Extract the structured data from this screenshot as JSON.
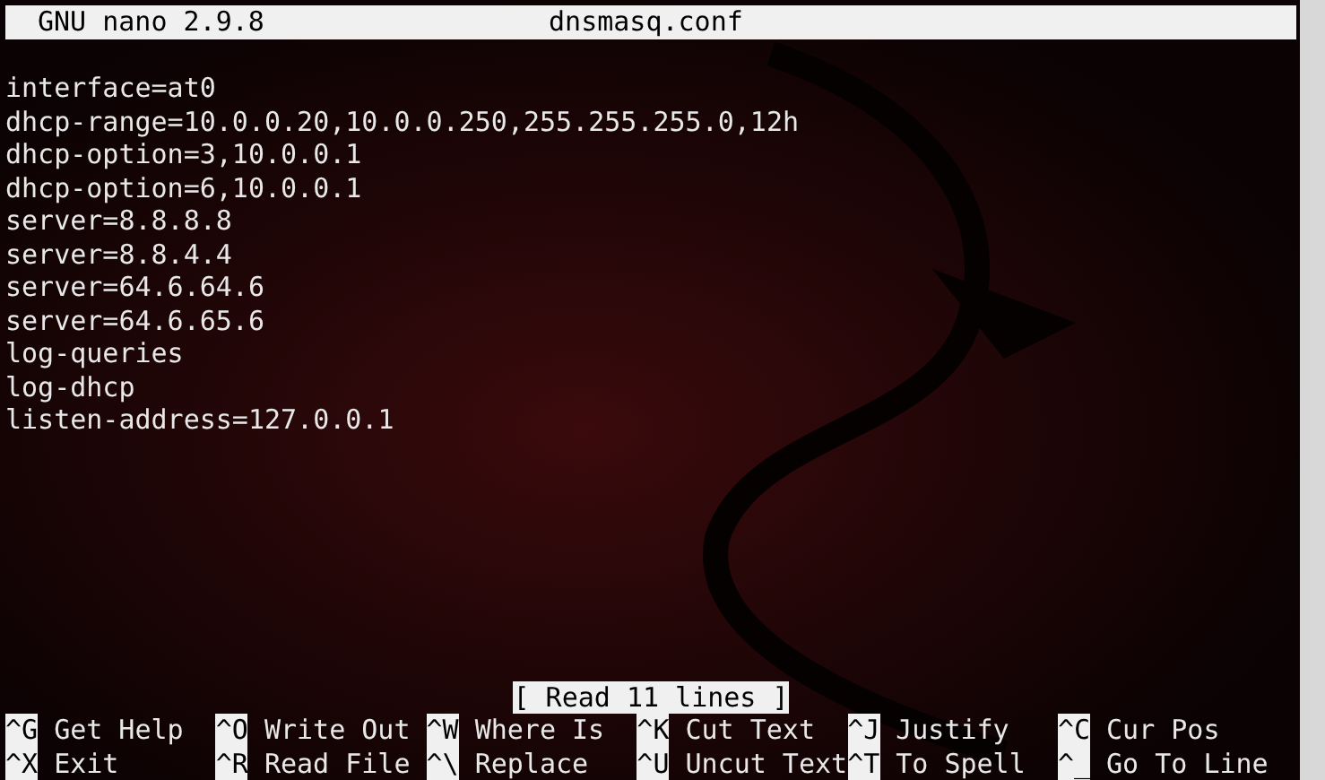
{
  "title_bar": {
    "app": "GNU nano 2.9.8",
    "filename": "dnsmasq.conf"
  },
  "lines": [
    "interface=at0",
    "dhcp-range=10.0.0.20,10.0.0.250,255.255.255.0,12h",
    "dhcp-option=3,10.0.0.1",
    "dhcp-option=6,10.0.0.1",
    "server=8.8.8.8",
    "server=8.8.4.4",
    "server=64.6.64.6",
    "server=64.6.65.6",
    "log-queries",
    "log-dhcp",
    "listen-address=127.0.0.1"
  ],
  "status": "[ Read 11 lines ]",
  "shortcuts": [
    [
      {
        "key": "^G",
        "label": "Get Help"
      },
      {
        "key": "^O",
        "label": "Write Out"
      },
      {
        "key": "^W",
        "label": "Where Is"
      },
      {
        "key": "^K",
        "label": "Cut Text"
      },
      {
        "key": "^J",
        "label": "Justify"
      },
      {
        "key": "^C",
        "label": "Cur Pos"
      }
    ],
    [
      {
        "key": "^X",
        "label": "Exit"
      },
      {
        "key": "^R",
        "label": "Read File"
      },
      {
        "key": "^\\",
        "label": "Replace"
      },
      {
        "key": "^U",
        "label": "Uncut Text"
      },
      {
        "key": "^T",
        "label": "To Spell"
      },
      {
        "key": "^_",
        "label": "Go To Line"
      }
    ]
  ]
}
